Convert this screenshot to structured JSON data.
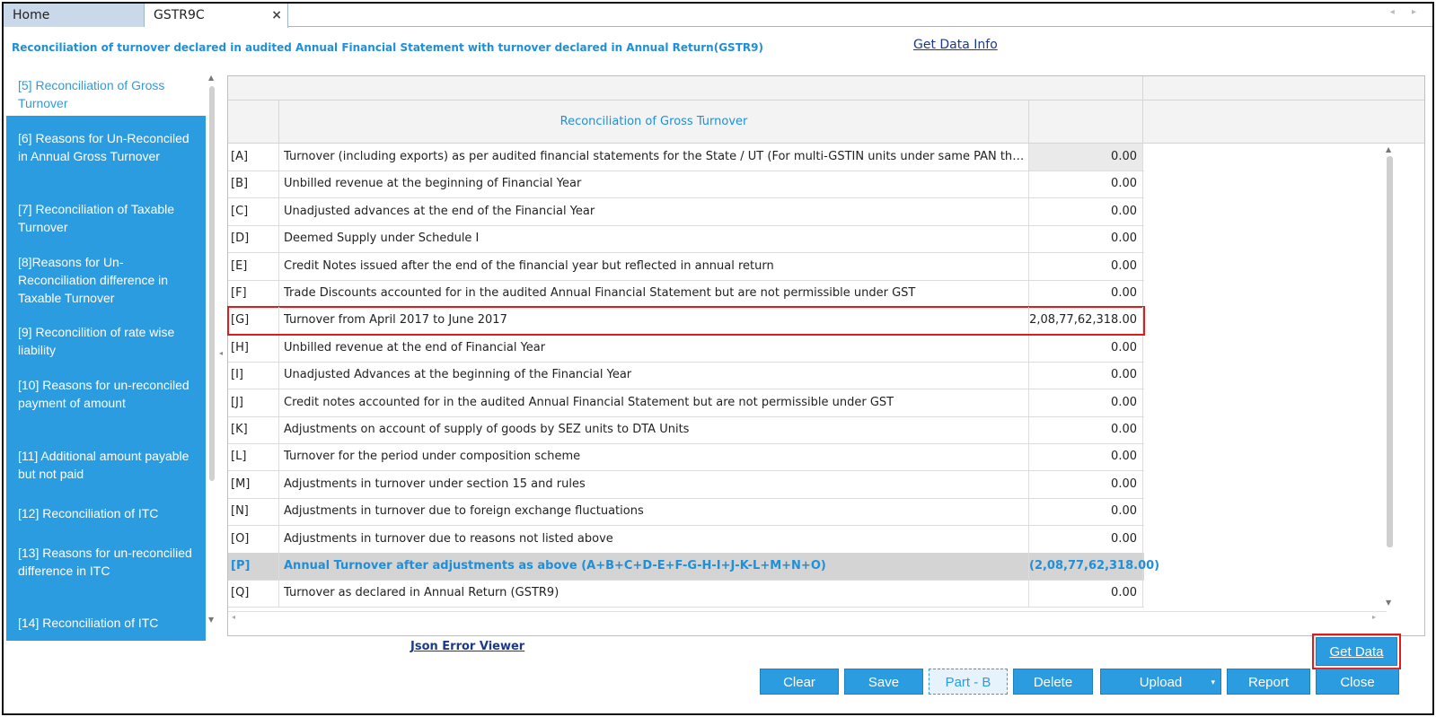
{
  "tabs": {
    "home": "Home",
    "active": "GSTR9C",
    "close_glyph": "×",
    "nav_glyphs": "◂ ▸"
  },
  "header": {
    "title": "Reconciliation of turnover declared in audited Annual Financial Statement with turnover declared in Annual Return(GSTR9)",
    "get_data_info": "Get Data Info"
  },
  "sidebar": {
    "items": [
      {
        "label": "[5] Reconciliation of Gross Turnover",
        "active": true
      },
      {
        "label": "[6] Reasons for Un-Reconciled in Annual Gross Turnover"
      },
      {
        "label": "[7] Reconciliation of Taxable Turnover"
      },
      {
        "label": "[8]Reasons for Un-Reconciliation difference in Taxable Turnover"
      },
      {
        "label": "[9] Reconcilition of rate wise liability"
      },
      {
        "label": "[10] Reasons for un-reconciled payment of amount"
      },
      {
        "label": "[11] Additional amount payable but not paid"
      },
      {
        "label": "[12] Reconciliation of ITC"
      },
      {
        "label": "[13] Reasons for un-reconcilied difference in ITC"
      },
      {
        "label": "[14] Reconciliation of ITC"
      }
    ]
  },
  "grid": {
    "column_header": "Reconciliation of Gross Turnover",
    "rows": [
      {
        "code": "[A]",
        "desc": "Turnover (including exports) as per audited financial statements for the State / UT (For multi-GSTIN units under same PAN the turnover shall be...",
        "value": "0.00"
      },
      {
        "code": "[B]",
        "desc": "Unbilled revenue at the beginning of Financial Year",
        "value": "0.00"
      },
      {
        "code": "[C]",
        "desc": "Unadjusted advances at the end of the Financial Year",
        "value": "0.00"
      },
      {
        "code": "[D]",
        "desc": "Deemed Supply under Schedule I",
        "value": "0.00"
      },
      {
        "code": "[E]",
        "desc": "Credit Notes issued after the end of the financial year but reflected in annual return",
        "value": "0.00"
      },
      {
        "code": "[F]",
        "desc": "Trade Discounts accounted for in the audited Annual Financial Statement but are not permissible under GST",
        "value": "0.00"
      },
      {
        "code": "[G]",
        "desc": "Turnover from April 2017 to June 2017",
        "value": "2,08,77,62,318.00"
      },
      {
        "code": "[H]",
        "desc": "Unbilled revenue at the end of Financial Year",
        "value": "0.00"
      },
      {
        "code": "[I]",
        "desc": "Unadjusted Advances at the beginning of the Financial Year",
        "value": "0.00"
      },
      {
        "code": "[J]",
        "desc": "Credit notes accounted for in the audited Annual Financial Statement but are not permissible under GST",
        "value": "0.00"
      },
      {
        "code": "[K]",
        "desc": "Adjustments on account of supply of goods by SEZ units to DTA Units",
        "value": "0.00"
      },
      {
        "code": "[L]",
        "desc": "Turnover for the period under composition scheme",
        "value": "0.00"
      },
      {
        "code": "[M]",
        "desc": "Adjustments in turnover under section 15 and rules",
        "value": "0.00"
      },
      {
        "code": "[N]",
        "desc": "Adjustments in turnover due to foreign exchange fluctuations",
        "value": "0.00"
      },
      {
        "code": "[O]",
        "desc": "Adjustments in turnover due to reasons not listed above",
        "value": "0.00"
      },
      {
        "code": "[P]",
        "desc": "Annual Turnover after adjustments as above (A+B+C+D-E+F-G-H-I+J-K-L+M+N+O)",
        "value": "(2,08,77,62,318.00)"
      },
      {
        "code": "[Q]",
        "desc": "Turnover as declared in Annual Return (GSTR9)",
        "value": "0.00"
      }
    ]
  },
  "footer": {
    "json_error_viewer": "Json Error Viewer",
    "get_data": "Get Data",
    "buttons": {
      "clear": "Clear",
      "save": "Save",
      "part_b": "Part - B",
      "delete": "Delete",
      "upload": "Upload",
      "report": "Report",
      "close": "Close"
    }
  },
  "colors": {
    "accent": "#2c9ce0",
    "highlight_border": "#e11b1b",
    "link": "#1b3a8a"
  }
}
